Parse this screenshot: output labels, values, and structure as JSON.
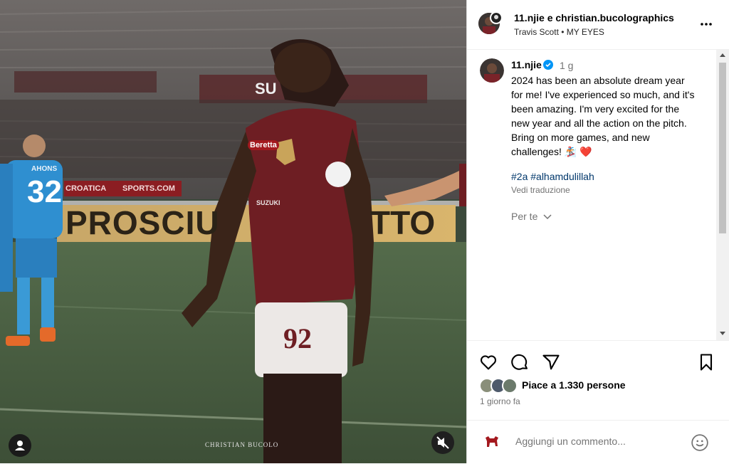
{
  "media": {
    "watermark": "CHRISTIAN BUCOLO",
    "jersey_back_number": "32",
    "jersey_back_name": "AHONS",
    "shorts_number": "92",
    "banner_left": "PROSCIU",
    "banner_right": "TTO",
    "board_text_1": "CROATICA",
    "board_text_2": "SPORTS.COM",
    "stand_text": "SU",
    "sponsor": "Beretta",
    "shirt_sponsor": "SUZUKI"
  },
  "header": {
    "accounts": "11.njie e christian.bucolographics",
    "audio": "Travis Scott • MY EYES",
    "more_icon": "more-icon"
  },
  "caption": {
    "username": "11.njie",
    "time": "1 g",
    "text": "2024 has been an absolute dream year for me! I've experienced so much, and it's been amazing. I'm very excited for the new year and all the action on the pitch. Bring on more games, and new challenges! 🏂 ❤️",
    "hashtags": "#2a #alhamdulillah",
    "translate": "Vedi traduzione",
    "for_you": "Per te"
  },
  "actions": {
    "likes": "Piace a 1.330 persone",
    "date": "1 giorno fa"
  },
  "comment": {
    "placeholder": "Aggiungi un commento..."
  },
  "colors": {
    "verified": "#0095f6",
    "heart": "#ed4956",
    "link": "#00376b",
    "jersey": "#6e1e23"
  }
}
